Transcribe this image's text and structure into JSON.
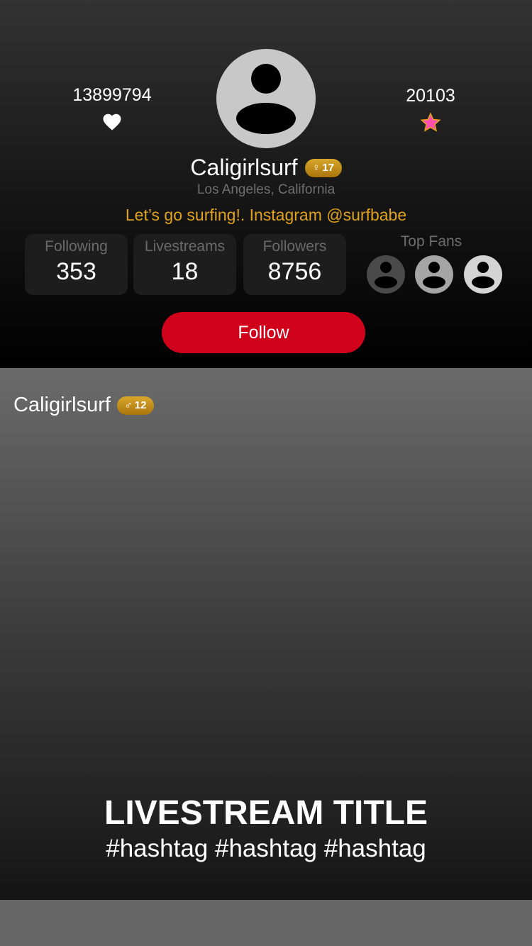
{
  "profile": {
    "likes_count": "13899794",
    "stars_count": "20103",
    "username": "Caligirlsurf",
    "badge": {
      "symbol": "♀",
      "level": "17"
    },
    "location": "Los Angeles, California",
    "bio": "Let’s go surfing!. Instagram @surfbabe",
    "stats": [
      {
        "label": "Following",
        "value": "353"
      },
      {
        "label": "Livestreams",
        "value": "18"
      },
      {
        "label": "Followers",
        "value": "8756"
      }
    ],
    "top_fans_label": "Top Fans",
    "follow_label": "Follow"
  },
  "livestream": {
    "username": "Caligirlsurf",
    "badge": {
      "symbol": "♂",
      "level": "12"
    },
    "title": "LIVESTREAM TITLE",
    "hashtags": "#hashtag #hashtag #hashtag"
  },
  "colors": {
    "accent_red": "#d0021b",
    "bio_gold": "#e0a21e",
    "badge_gold": "#c18d1b",
    "star_pink": "#ff4fb0",
    "star_outline": "#e8a317"
  },
  "icons": [
    "heart-icon",
    "star-icon",
    "avatar-icon"
  ]
}
